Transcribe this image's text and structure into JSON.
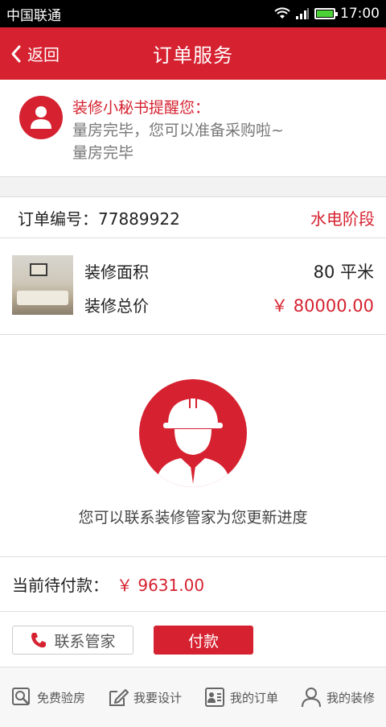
{
  "statusbar": {
    "carrier": "中国联通",
    "time": "17:00"
  },
  "navbar": {
    "back_label": "返回",
    "title": "订单服务"
  },
  "reminder": {
    "title": "装修小秘书提醒您：",
    "line1": "量房完毕，您可以准备采购啦~",
    "line2": "量房完毕"
  },
  "order": {
    "number_label": "订单编号：77889922",
    "stage": "水电阶段"
  },
  "house": {
    "area_label": "装修面积",
    "area_value": "80 平米",
    "total_label": "装修总价",
    "total_value": "￥ 80000.00"
  },
  "worker": {
    "message": "您可以联系装修管家为您更新进度"
  },
  "pending": {
    "label": "当前待付款：",
    "amount": "￥ 9631.00"
  },
  "actions": {
    "contact_label": "联系管家",
    "pay_label": "付款"
  },
  "tabbar": {
    "items": [
      {
        "label": "免费验房",
        "icon": "search-icon"
      },
      {
        "label": "我要设计",
        "icon": "edit-icon"
      },
      {
        "label": "我的订单",
        "icon": "order-icon"
      },
      {
        "label": "我的装修",
        "icon": "person-icon"
      }
    ]
  },
  "colors": {
    "brand": "#d62230",
    "background": "#f2f2f2"
  }
}
